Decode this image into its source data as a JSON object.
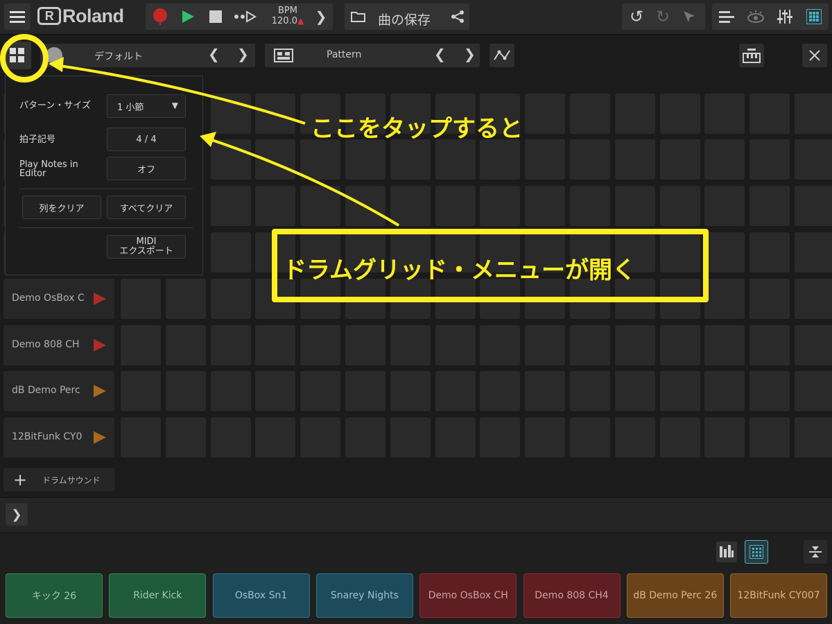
{
  "toolbar": {
    "logo_text": "Roland",
    "bpm_label": "BPM",
    "bpm_value": "120.0",
    "save_label": "曲の保存"
  },
  "secondbar": {
    "kit_name": "デフォルト",
    "pattern_name": "Pattern"
  },
  "popup": {
    "pattern_size_label": "パターン・サイズ",
    "pattern_size_value": "1 小節",
    "time_signature_label": "拍子記号",
    "time_signature_value": "4 / 4",
    "play_notes_label_1": "Play Notes in",
    "play_notes_label_2": "Editor",
    "play_notes_value": "オフ",
    "clear_column": "列をクリア",
    "clear_all": "すべてクリア",
    "midi_export_1": "MIDI",
    "midi_export_2": "エクスポート"
  },
  "tracks": [
    {
      "name": "Demo OsBox C",
      "color": "#b02a2a"
    },
    {
      "name": "Demo 808 CH",
      "color": "#b02a2a"
    },
    {
      "name": "dB Demo Perc",
      "color": "#a86a1c"
    },
    {
      "name": "12BitFunk CY0",
      "color": "#a86a1c"
    }
  ],
  "add_track_label": "ドラムサウンド",
  "pads": [
    {
      "name": "キック 26",
      "bg": "#1f5a3a",
      "border": "#2f8a57",
      "text": "#9fc9ad"
    },
    {
      "name": "Rider Kick",
      "bg": "#1f5a3a",
      "border": "#2f8a57",
      "text": "#9fc9ad"
    },
    {
      "name": "OsBox Sn1",
      "bg": "#1d4b5c",
      "border": "#2a7590",
      "text": "#9dc0cc"
    },
    {
      "name": "Snarey Nights",
      "bg": "#1d4b5c",
      "border": "#2a7590",
      "text": "#9dc0cc"
    },
    {
      "name": "Demo OsBox CH",
      "bg": "#5e1e22",
      "border": "#8e2c32",
      "text": "#d0a0a4"
    },
    {
      "name": "Demo 808 CH4",
      "bg": "#5e1e22",
      "border": "#8e2c32",
      "text": "#d0a0a4"
    },
    {
      "name": "dB Demo Perc 26",
      "bg": "#6a431a",
      "border": "#9c6426",
      "text": "#d6b88e"
    },
    {
      "name": "12BitFunk CY007",
      "bg": "#6a431a",
      "border": "#9c6426",
      "text": "#d6b88e"
    }
  ],
  "annotations": {
    "tap_here": "ここをタップすると",
    "menu_opens": "ドラムグリッド・メニューが開く",
    "color": "#ffee22"
  }
}
